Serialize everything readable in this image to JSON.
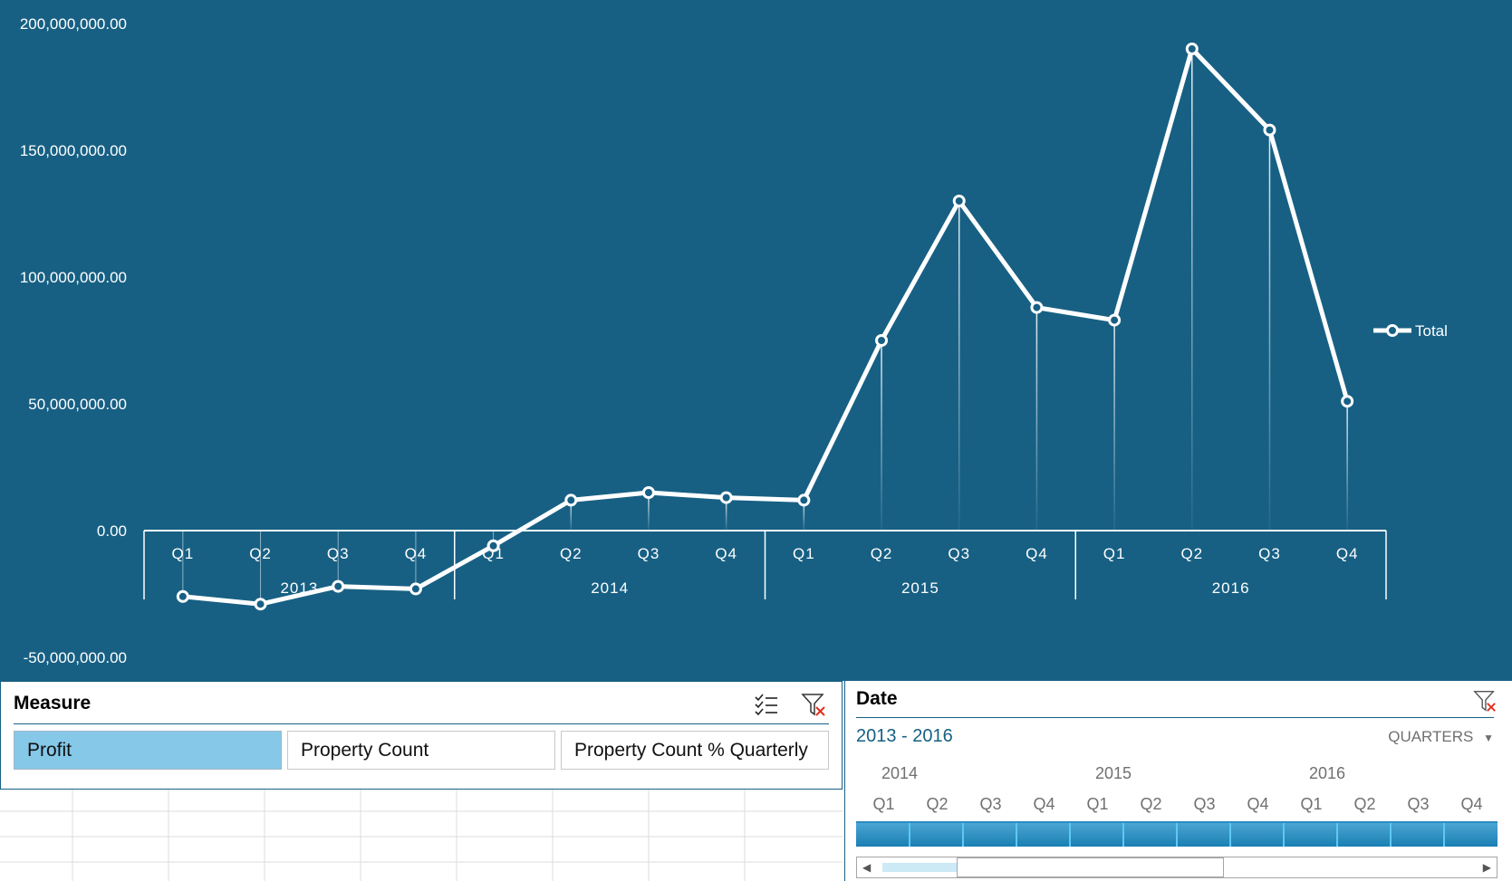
{
  "chart_data": {
    "type": "line",
    "title": "",
    "ylim": [
      -50000000,
      200000000
    ],
    "yticks": [
      "200,000,000.00",
      "150,000,000.00",
      "100,000,000.00",
      "50,000,000.00",
      "0.00",
      "-50,000,000.00"
    ],
    "ytick_values": [
      200000000,
      150000000,
      100000000,
      50000000,
      0,
      -50000000
    ],
    "years": [
      "2013",
      "2014",
      "2015",
      "2016"
    ],
    "quarters": [
      "Q1",
      "Q2",
      "Q3",
      "Q4"
    ],
    "series": [
      {
        "name": "Total",
        "values": [
          -26000000,
          -29000000,
          -22000000,
          -23000000,
          -6000000,
          12000000,
          15000000,
          13000000,
          12000000,
          75000000,
          130000000,
          88000000,
          83000000,
          190000000,
          158000000,
          51000000
        ]
      }
    ],
    "legend": "right",
    "grid": false
  },
  "measure_slicer": {
    "title": "Measure",
    "icons": [
      "multi-select-icon",
      "clear-filter-icon"
    ],
    "buttons": [
      {
        "label": "Profit",
        "selected": true
      },
      {
        "label": "Property Count",
        "selected": false
      },
      {
        "label": "Property Count % Quarterly",
        "selected": false
      }
    ]
  },
  "date_timeline": {
    "title": "Date",
    "range": "2013 - 2016",
    "level": "QUARTERS",
    "years": [
      "2014",
      "2015",
      "2016"
    ],
    "quarters": [
      "Q1",
      "Q2",
      "Q3",
      "Q4",
      "Q1",
      "Q2",
      "Q3",
      "Q4",
      "Q1",
      "Q2",
      "Q3",
      "Q4"
    ],
    "icons": [
      "clear-filter-icon",
      "dropdown-arrow-icon",
      "scroll-left-icon",
      "scroll-right-icon"
    ],
    "colors": {
      "bar": "#1a7fb3",
      "accent": "#176084"
    }
  }
}
